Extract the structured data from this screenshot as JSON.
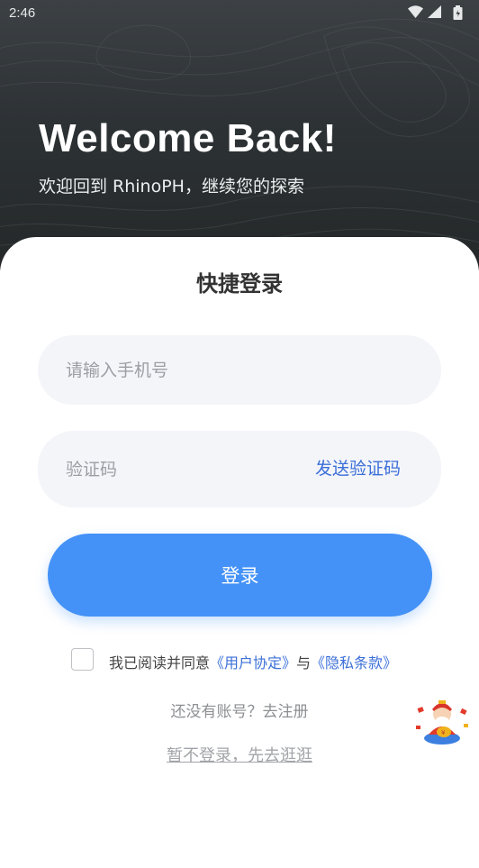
{
  "status_bar": {
    "time": "2:46"
  },
  "hero": {
    "title": "Welcome Back!",
    "subtitle": "欢迎回到 RhinoPH，继续您的探索"
  },
  "login_card": {
    "title": "快捷登录",
    "phone_placeholder": "请输入手机号",
    "code_placeholder": "验证码",
    "send_code_label": "发送验证码",
    "login_label": "登录",
    "agreement": {
      "prefix": "我已阅读并同意",
      "user_agreement": "《用户协定》",
      "conjunction": "与",
      "privacy_policy": "《隐私条款》",
      "checked": false
    },
    "register_label": "还没有账号？去注册",
    "skip_label": "暂不登录，先去逛逛"
  },
  "colors": {
    "primary": "#4492f7",
    "link": "#3b6fd8",
    "hero_background": "#2d3235"
  },
  "icons": [
    "wifi-icon",
    "signal-icon",
    "battery-icon",
    "mascot-icon"
  ]
}
